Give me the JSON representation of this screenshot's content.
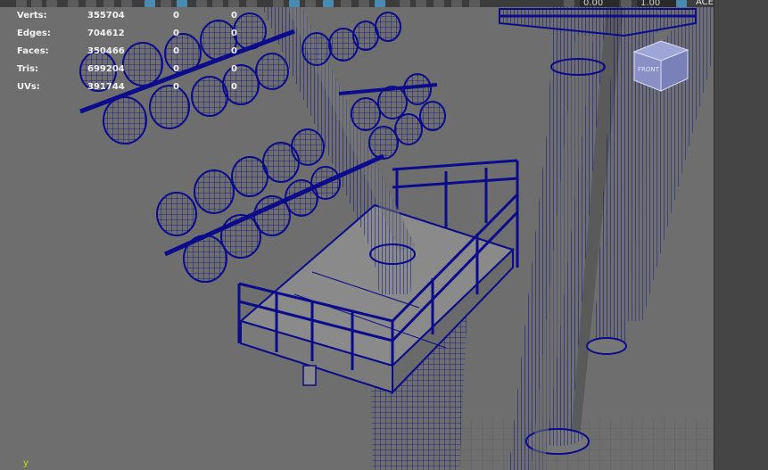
{
  "toolbar": {
    "translate_value": "0.00",
    "scale_value": "1.00",
    "color_space_label": "ACE"
  },
  "hud": {
    "stats": [
      {
        "label": "Verts:",
        "total": "355704",
        "selected": "0",
        "component": "0"
      },
      {
        "label": "Edges:",
        "total": "704612",
        "selected": "0",
        "component": "0"
      },
      {
        "label": "Faces:",
        "total": "350466",
        "selected": "0",
        "component": "0"
      },
      {
        "label": "Tris:",
        "total": "699204",
        "selected": "0",
        "component": "0"
      },
      {
        "label": "UVs:",
        "total": "391744",
        "selected": "0",
        "component": "0"
      }
    ]
  },
  "axis": {
    "y_label": "y"
  },
  "viewcube": {
    "face_label": "FRONT"
  },
  "colors": {
    "viewport_bg": "#6e6e6e",
    "wireframe": "#0b0b8c",
    "axis_y": "#c8e000",
    "toolbar_accent": "#4a8ab0"
  }
}
